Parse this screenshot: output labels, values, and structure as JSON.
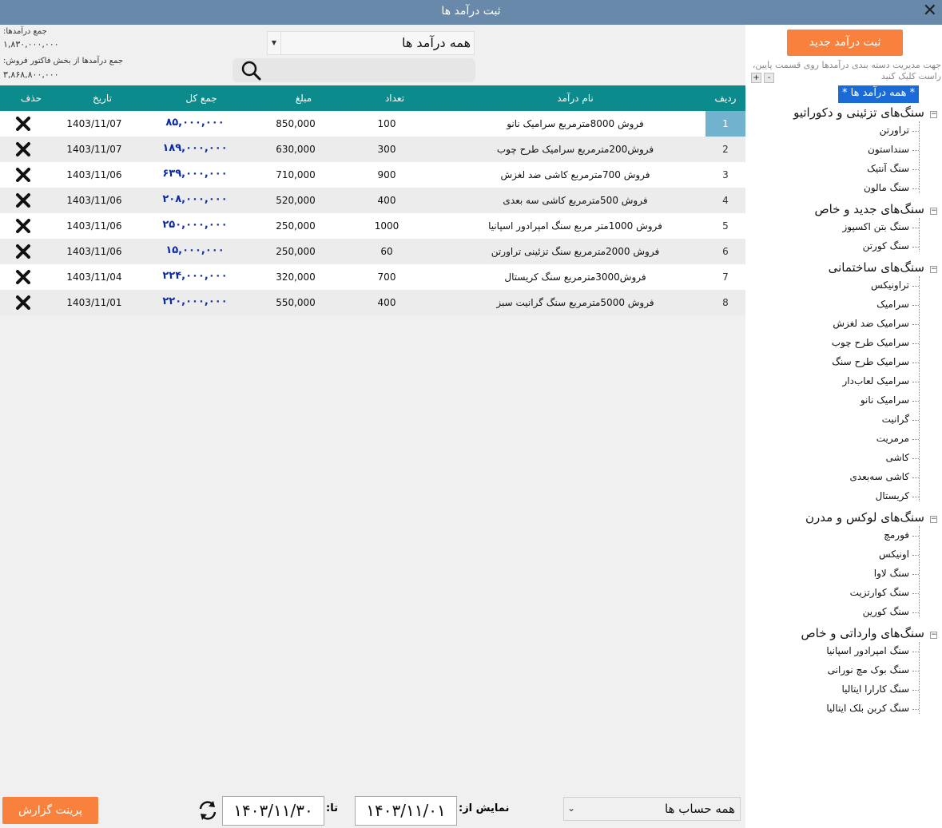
{
  "window": {
    "title": "ثبت درآمد ها",
    "close": "✕"
  },
  "summary": {
    "total_label": "جمع درآمدها:",
    "total_value": "۱,۸۳۰,۰۰۰,۰۰۰",
    "invoice_label": "جمع درآمدها از بخش فاکتور فروش:",
    "invoice_value": "۳,۸۶۸,۸۰۰,۰۰۰"
  },
  "filter": {
    "selected": "همه درآمد ها",
    "search_placeholder": ""
  },
  "table": {
    "headers": {
      "idx": "ردیف",
      "name": "نام درآمد",
      "qty": "تعداد",
      "amount": "مبلغ",
      "total": "جمع کل",
      "date": "تاریخ",
      "delete": "حذف"
    },
    "rows": [
      {
        "idx": "1",
        "name": "فروش 8000مترمربع سرامیک نانو",
        "qty": "100",
        "amount": "850,000",
        "total": "۸۵,۰۰۰,۰۰۰",
        "date": "1403/11/07"
      },
      {
        "idx": "2",
        "name": "فروش200مترمربع سرامیک طرح چوب",
        "qty": "300",
        "amount": "630,000",
        "total": "۱۸۹,۰۰۰,۰۰۰",
        "date": "1403/11/07"
      },
      {
        "idx": "3",
        "name": "فروش 700مترمربع کاشی ضد لغزش",
        "qty": "900",
        "amount": "710,000",
        "total": "۶۳۹,۰۰۰,۰۰۰",
        "date": "1403/11/06"
      },
      {
        "idx": "4",
        "name": "فروش 500مترمربع کاشی سه بعدی",
        "qty": "400",
        "amount": "520,000",
        "total": "۲۰۸,۰۰۰,۰۰۰",
        "date": "1403/11/06"
      },
      {
        "idx": "5",
        "name": "فروش 1000متر مربع سنگ امپرادور اسپانیا",
        "qty": "1000",
        "amount": "250,000",
        "total": "۲۵۰,۰۰۰,۰۰۰",
        "date": "1403/11/06"
      },
      {
        "idx": "6",
        "name": "فروش 2000مترمربع سنگ تزئینی تراورتن",
        "qty": "60",
        "amount": "250,000",
        "total": "۱۵,۰۰۰,۰۰۰",
        "date": "1403/11/06"
      },
      {
        "idx": "7",
        "name": "فروش3000مترمربع سنگ کریستال",
        "qty": "700",
        "amount": "320,000",
        "total": "۲۲۴,۰۰۰,۰۰۰",
        "date": "1403/11/04"
      },
      {
        "idx": "8",
        "name": "فروش 5000مترمربع سنگ گرانیت سبز",
        "qty": "400",
        "amount": "550,000",
        "total": "۲۲۰,۰۰۰,۰۰۰",
        "date": "1403/11/01"
      }
    ]
  },
  "footer": {
    "account": "همه حساب ها",
    "from_label": "نمایش از:",
    "from_date": "۱۴۰۳/۱۱/۰۱",
    "to_label": "تا:",
    "to_date": "۱۴۰۳/۱۱/۳۰",
    "print_label": "پرینت گزارش"
  },
  "side": {
    "new_label": "ثبت درآمد جدید",
    "hint": "جهت مدیریت دسته بندی درآمدها روی قسمت پایین، راست کلیک کنید",
    "plus": "+",
    "minus": "-",
    "root": "* همه درآمد ها *",
    "groups": [
      {
        "label": "سنگ‌های تزئینی و دکوراتیو",
        "items": [
          "تراورتن",
          "سنداستون",
          "سنگ آنتیک",
          "سنگ مالون"
        ]
      },
      {
        "label": "سنگ‌های جدید و خاص",
        "items": [
          "سنگ بتن اکسپوز",
          "سنگ کورتن"
        ]
      },
      {
        "label": "سنگ‌های ساختمانی",
        "items": [
          "تراونیکس",
          "سرامیک",
          "سرامیک ضد لغزش",
          "سرامیک طرح چوب",
          "سرامیک طرح سنگ",
          "سرامیک لعاب‌دار",
          "سرامیک نانو",
          "گرانیت",
          "مرمریت",
          "کاشی",
          "کاشی سه‌بعدی",
          "کریستال"
        ]
      },
      {
        "label": "سنگ‌های لوکس و مدرن",
        "items": [
          "فورمچ",
          "اونیکس",
          "سنگ لاوا",
          "سنگ کوارتزیت",
          "سنگ کورین"
        ]
      },
      {
        "label": "سنگ‌های وارداتی و خاص",
        "items": [
          "سنگ امپرادور اسپانیا",
          "سنگ بوک مچ نورانی",
          "سنگ کارارا ایتالیا",
          "سنگ کربن بلک ایتالیا"
        ]
      }
    ]
  }
}
